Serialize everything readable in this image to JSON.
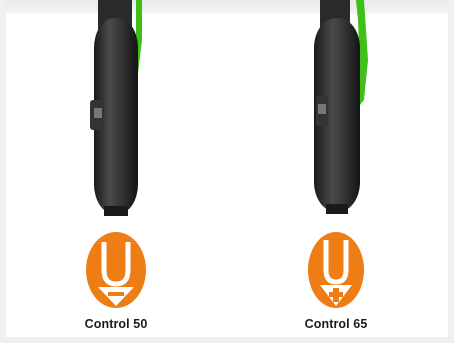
{
  "colors": {
    "accent": "#ef7d15",
    "frame_green": "#3fbf1a",
    "tire": "#2b2b2b"
  },
  "panels": [
    {
      "label": "Control 50",
      "icon": "minus-icon"
    },
    {
      "label": "Control 65",
      "icon": "plus-icon"
    }
  ]
}
